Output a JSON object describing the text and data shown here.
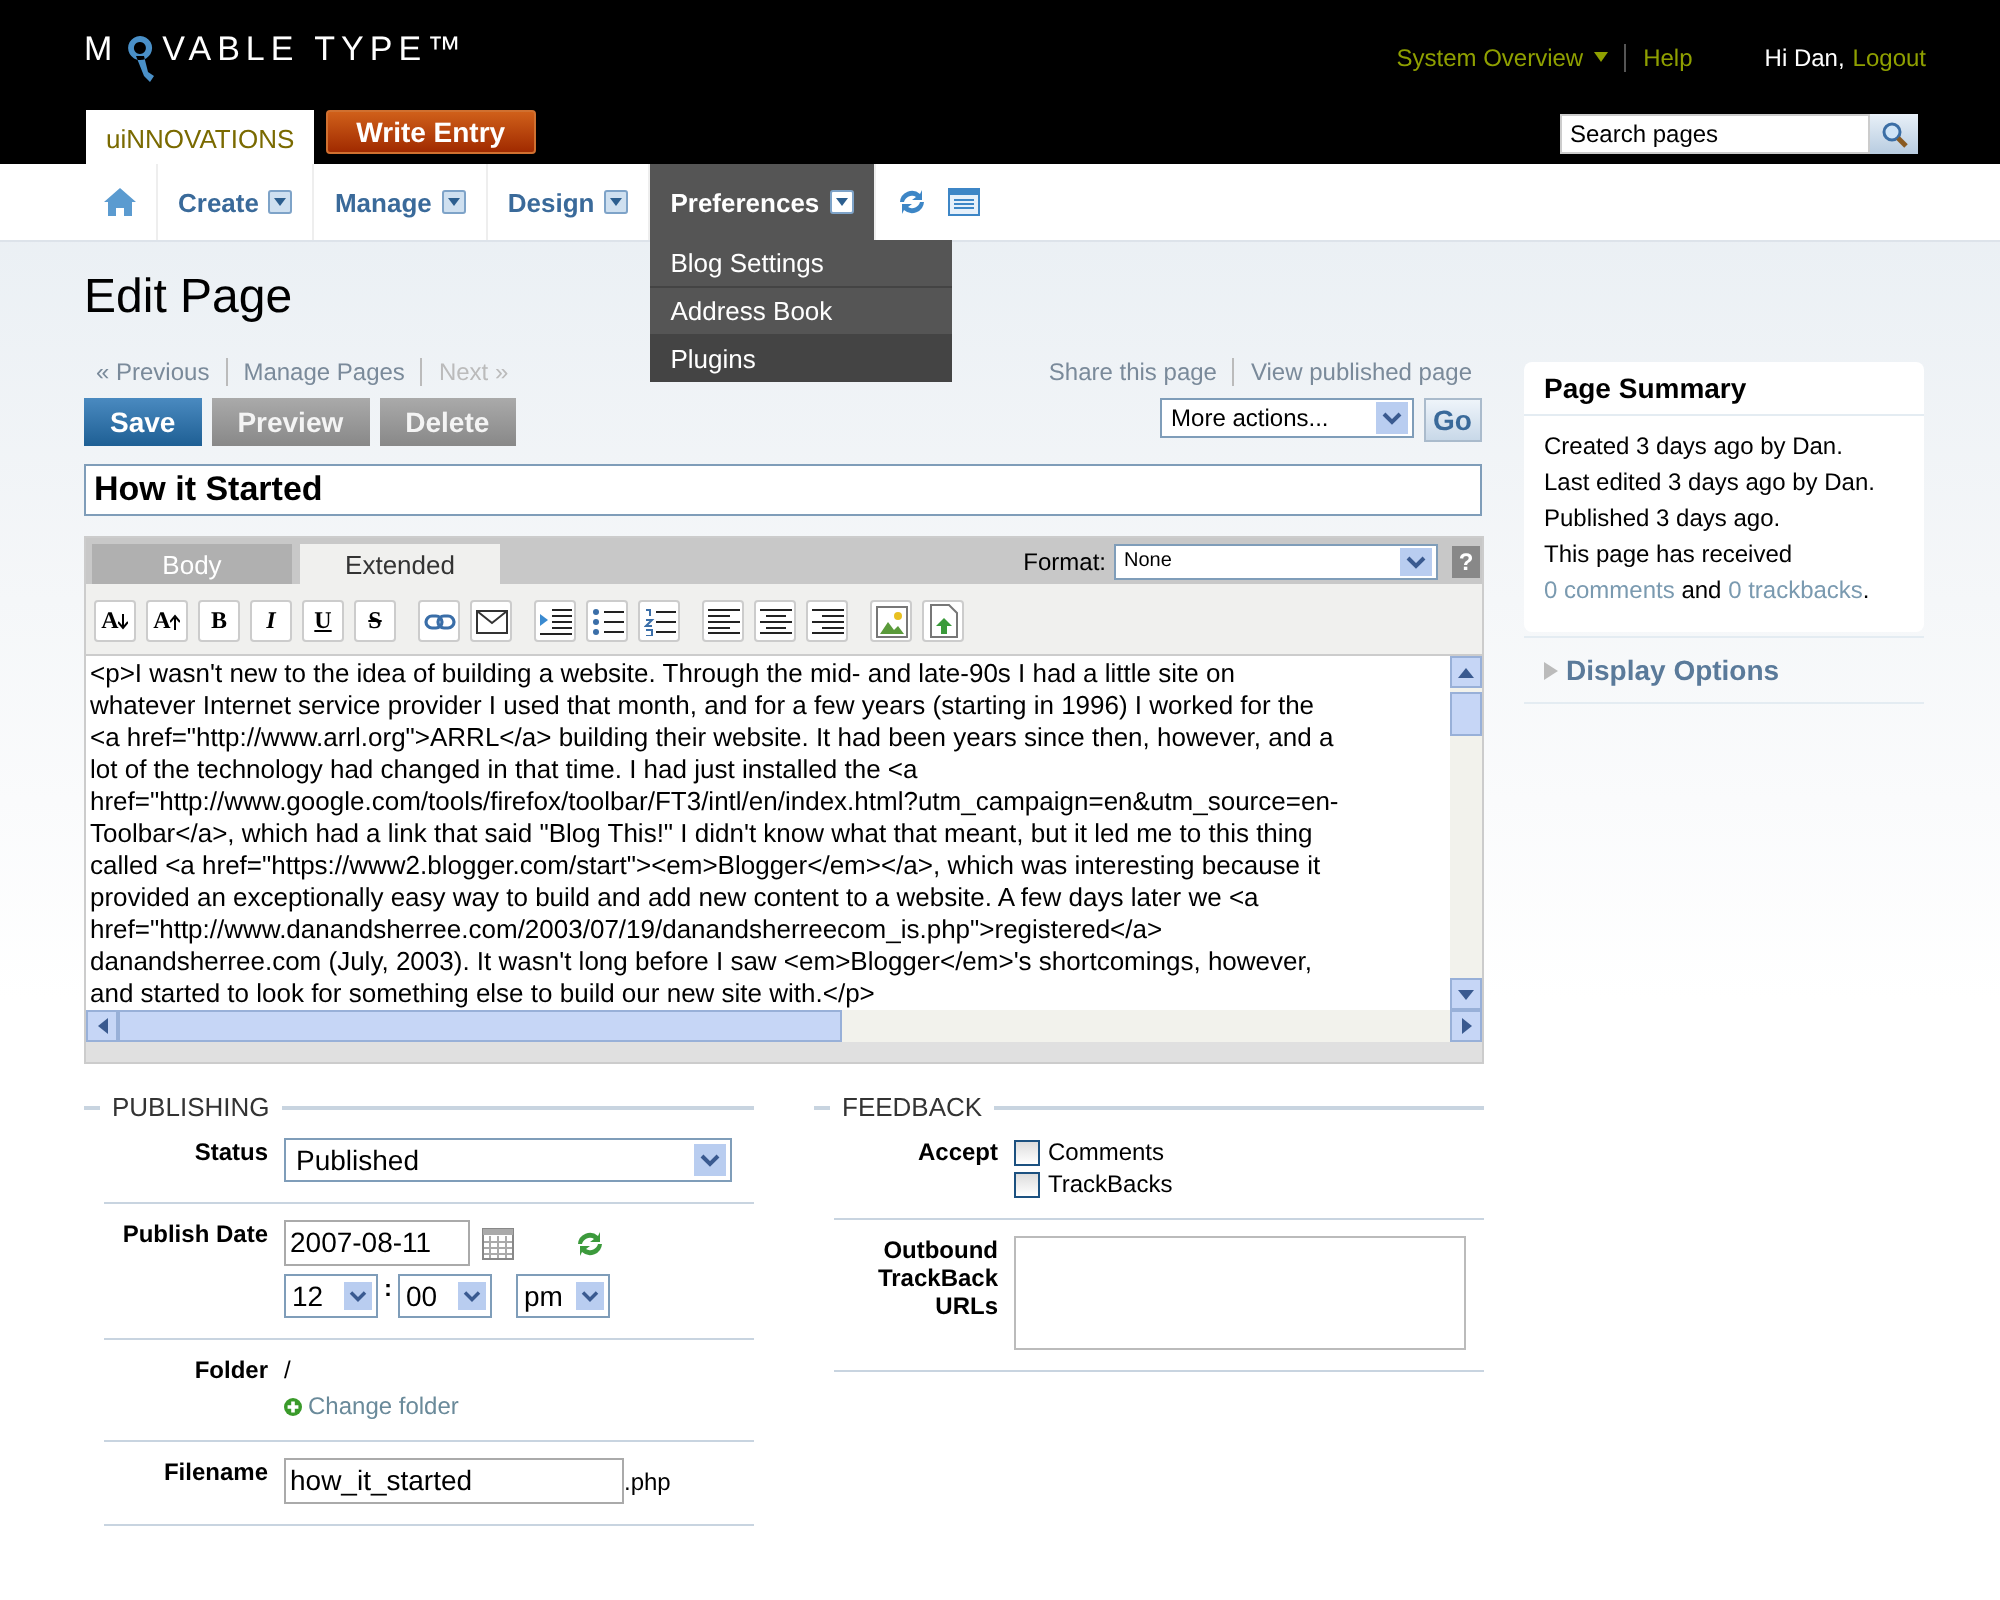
{
  "header": {
    "logo_before": "M",
    "logo_after": "VABLE TYPE™",
    "links": [
      {
        "label": "System Overview",
        "dropdown": true
      },
      {
        "label": "Help",
        "dropdown": false
      }
    ],
    "greeting": "Hi Dan,",
    "logout": "Logout",
    "blog_tab": "uiNNOVATIONS",
    "write_button": "Write Entry",
    "search": {
      "placeholder": "Search pages"
    }
  },
  "nav": {
    "items": [
      {
        "label": "Create",
        "selected": false
      },
      {
        "label": "Manage",
        "selected": false
      },
      {
        "label": "Design",
        "selected": false
      },
      {
        "label": "Preferences",
        "selected": true
      }
    ],
    "menu": [
      {
        "label": "Blog Settings",
        "selected": false
      },
      {
        "label": "Address Book",
        "selected": false
      },
      {
        "label": "Plugins",
        "selected": true
      }
    ]
  },
  "page_title": "Edit Page",
  "page_links": [
    {
      "label": "« Previous",
      "disabled": false
    },
    {
      "label": "Manage Pages",
      "disabled": false
    },
    {
      "label": "Next »",
      "disabled": true
    }
  ],
  "share_links": [
    "Share this page",
    "View published page"
  ],
  "actions": [
    {
      "label": "Save",
      "kind": "primary"
    },
    {
      "label": "Preview",
      "kind": "secondary"
    },
    {
      "label": "Delete",
      "kind": "secondary"
    }
  ],
  "more_actions": {
    "value": "More actions...",
    "go": "Go"
  },
  "title_field": {
    "value": "How it Started"
  },
  "editor": {
    "tabs": [
      {
        "label": "Body",
        "selected": false
      },
      {
        "label": "Extended",
        "selected": true
      }
    ],
    "format_label": "Format:",
    "format_value": "None",
    "help": "?",
    "tools": [
      {
        "kind": "font-smaller",
        "label": "A"
      },
      {
        "kind": "font-larger",
        "label": "A"
      },
      {
        "kind": "bold",
        "label": "B"
      },
      {
        "kind": "italic",
        "label": "I"
      },
      {
        "kind": "underline",
        "label": "U"
      },
      {
        "kind": "strike",
        "label": "S"
      },
      {
        "kind": "link"
      },
      {
        "kind": "email"
      },
      {
        "kind": "indent"
      },
      {
        "kind": "bullets"
      },
      {
        "kind": "numbers"
      },
      {
        "kind": "align-left"
      },
      {
        "kind": "align-center"
      },
      {
        "kind": "align-right"
      },
      {
        "kind": "image"
      },
      {
        "kind": "upload"
      }
    ],
    "lines": [
      "<p>I wasn't new to the idea of building a website. Through the mid- and late-90s I had a little site on",
      "whatever Internet service provider I used that month, and for a few years (starting in 1996) I worked for the",
      "<a href=\"http://www.arrl.org\">ARRL</a> building their website. It had been years since then, however, and a",
      "lot of the technology had changed in that time. I had just installed the <a",
      "href=\"http://www.google.com/tools/firefox/toolbar/FT3/intl/en/index.html?utm_campaign=en&utm_source=en-",
      "Toolbar</a>, which had a link that said \"Blog This!\" I didn't know what that meant, but it led me to this thing",
      "called <a href=\"https://www2.blogger.com/start\"><em>Blogger</em></a>, which was interesting because it",
      "provided an exceptionally easy way to build and add new content to a website. A few days later we <a",
      "href=\"http://www.danandsherree.com/2003/07/19/danandsherreecom_is.php\">registered</a>",
      "danandsherree.com (July, 2003). It wasn't long before I saw <em>Blogger</em>'s shortcomings, however,",
      "and started to look for something else to build our new site with.</p>"
    ]
  },
  "publishing": {
    "legend": "PUBLISHING",
    "status_label": "Status",
    "status": "Published",
    "date_label": "Publish Date",
    "date": "2007-08-11",
    "hour": "12",
    "time_sep": ":",
    "minute": "00",
    "ampm": "pm",
    "folder_label": "Folder",
    "folder": "/",
    "change_folder": "Change folder",
    "filename_label": "Filename",
    "filename": "how_it_started",
    "extension": ".php"
  },
  "feedback": {
    "legend": "FEEDBACK",
    "accept_label": "Accept",
    "options": [
      {
        "label": "Comments",
        "checked": false
      },
      {
        "label": "TrackBacks",
        "checked": false
      }
    ],
    "urls_label": "Outbound TrackBack URLs"
  },
  "summary": {
    "title": "Page Summary",
    "lines": [
      "Created 3 days ago by Dan.",
      "Last edited 3 days ago by Dan.",
      "Published 3 days ago."
    ],
    "received": [
      {
        "text": "This page has received "
      },
      {
        "link": "0 comments"
      },
      {
        "text": " and "
      },
      {
        "link": "0 trackbacks"
      },
      {
        "text": "."
      }
    ],
    "display_options": "Display Options"
  }
}
